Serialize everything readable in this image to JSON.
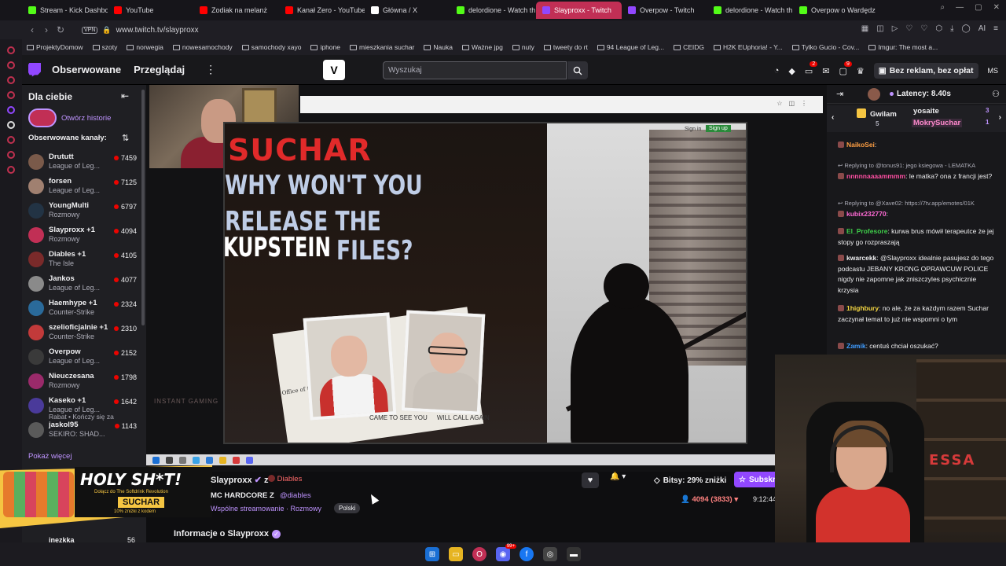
{
  "browser": {
    "tabs": [
      {
        "label": "Stream - Kick Dashbo",
        "color": "#53fc18"
      },
      {
        "label": "YouTube",
        "color": "#ff0000"
      },
      {
        "label": "Zodiak na melanż",
        "color": "#ff0000"
      },
      {
        "label": "Kanał Zero - YouTube",
        "color": "#ff0000"
      },
      {
        "label": "Główna / X",
        "color": "#ffffff"
      },
      {
        "label": "delordione - Watch th",
        "color": "#53fc18"
      },
      {
        "label": "Slayproxx - Twitch",
        "color": "#9147ff",
        "active": true
      },
      {
        "label": "Overpow - Twitch",
        "color": "#9147ff"
      },
      {
        "label": "delordione - Watch th",
        "color": "#53fc18"
      },
      {
        "label": "Overpow o Wardędz",
        "color": "#53fc18"
      }
    ],
    "vpn_label": "VPN",
    "url": "www.twitch.tv/slayproxx",
    "ai_label": "AI",
    "bookmarks": [
      "ProjektyDomow",
      "szoty",
      "norwegia",
      "nowesamochody",
      "samochody xayo",
      "iphone",
      "mieszkania suchar",
      "Nauka",
      "Ważne jpg",
      "nuty",
      "tweety do rt",
      "94 League of Leg...",
      "CEIDG",
      "H2K EUphoria! - Y...",
      "Tylko Gucio - Cov...",
      "Imgur: The most a..."
    ]
  },
  "twitch_nav": {
    "following": "Obserwowane",
    "browse": "Przeglądaj",
    "ext_logo": "V",
    "search_placeholder": "Wyszukaj",
    "notif_count_1": "2",
    "notif_count_2": "9",
    "no_ads": "Bez reklam, bez opłat",
    "avatar_initials": "MS"
  },
  "sidebar": {
    "for_you": "Dla ciebie",
    "open_stories": "Otwórz historie",
    "followed_channels": "Obserwowane kanały:",
    "channels": [
      {
        "name": "Drututt",
        "game": "League of Leg...",
        "viewers": "7459",
        "color": "#7a5a4a"
      },
      {
        "name": "forsen",
        "game": "League of Leg...",
        "viewers": "7125",
        "color": "#a08070"
      },
      {
        "name": "YoungMulti",
        "game": "Rozmowy",
        "viewers": "6797",
        "color": "#223344"
      },
      {
        "name": "Slayproxx +1",
        "game": "Rozmowy",
        "viewers": "4094",
        "color": "#c12f55"
      },
      {
        "name": "Diables +1",
        "game": "The Isle",
        "viewers": "4105",
        "color": "#7a2a2a"
      },
      {
        "name": "Jankos",
        "game": "League of Leg...",
        "viewers": "4077",
        "color": "#8a8a8a"
      },
      {
        "name": "Haemhype +1",
        "game": "Counter-Strike",
        "viewers": "2324",
        "color": "#2a6a9a"
      },
      {
        "name": "szelioficjalnie +1",
        "game": "Counter-Strike",
        "viewers": "2310",
        "color": "#c23a3a"
      },
      {
        "name": "Overpow",
        "game": "League of Leg...",
        "viewers": "2152",
        "color": "#3a3a3a"
      },
      {
        "name": "Nieuczesana",
        "game": "Rozmowy",
        "viewers": "1798",
        "color": "#9a2a6a"
      },
      {
        "name": "Kaseko +1",
        "game": "League of Leg...",
        "viewers": "1642",
        "color": "#4a3a9a"
      },
      {
        "name": "jaskol95",
        "game": "SEKIRO: SHAD...",
        "viewers": "1143",
        "color": "#5a5a5a"
      }
    ],
    "kaseko_note": "Rabat • Kończy się za",
    "show_more": "Pokaż więcej",
    "hidden_row_name": "inezkka",
    "hidden_row_viewers": "56"
  },
  "video": {
    "inner_signin": "Sign in",
    "inner_signup": "Sign up",
    "thumb_brand": "SUCHAR",
    "thumb_line1": "WHY WON'T YOU",
    "thumb_line2": "RELEASE THE",
    "thumb_kupstein": "KUPSTEIN",
    "thumb_files": "FILES?",
    "stamp_text": "Office of the Attorney General",
    "ticket1": "CAME TO SEE YOU",
    "ticket2": "WILL CALL AGAIN",
    "ic_logo": "INSTANT GAMING"
  },
  "chat": {
    "latency": "Latency: 8.40s",
    "gift_user_1": "Gwilam",
    "gift_count_1": "5",
    "gift_user_2": "yosaite",
    "gift_count_2": "3",
    "gift_user_3": "MokrySuchar",
    "gift_count_3": "1",
    "messages": [
      {
        "user": "NaikoSei",
        "user_color": "#ff9f43",
        "text": ":"
      },
      {
        "reply": "Replying to @tonus91: jego ksiegowa - LEMATKA"
      },
      {
        "user": "nnnnnaaaammmm",
        "user_color": "#ff4fa3",
        "text": ": le matka? ona z francji jest?"
      },
      {
        "reply": "Replying to @Xave02: https://7tv.app/emotes/01K"
      },
      {
        "user": "kubix232770",
        "user_color": "#ff6ad5",
        "text": ":"
      },
      {
        "user": "El_Profesore",
        "user_color": "#3fcf4a",
        "text": ": kurwa brus mówił terapeutce że jej stopy go rozpraszają"
      },
      {
        "user": "kwarcekk",
        "user_color": "#efeff1",
        "text": ": @Slayproxx idealnie pasujesz do tego podcastu JEBANY KRONG OPRAWCUW POLICE nigdy nie zapomne jak zniszczyles psychicznie krzysia"
      },
      {
        "user": "1highbury",
        "user_color": "#f5d742",
        "text": ": no ale, że za każdym razem Suchar zaczynał temat to już nie wspomni o tym"
      },
      {
        "user": "Zamik",
        "user_color": "#3f9cff",
        "text": ": centuś chciał oszukać?"
      }
    ]
  },
  "stream_info": {
    "streamer": "Slayproxx",
    "with_label": "z",
    "collab": "Diables",
    "title": "MC HARDCORE Z",
    "title_mention": "@diables",
    "category": "Wspólne streamowanie · Rozmowy",
    "language": "Polski",
    "about": "Informacje o Slayproxx",
    "bits": "Bitsy: 29% zniżki",
    "subscribe": "Subskrybuj",
    "viewers": "4094 (3833)",
    "uptime": "9:12:44"
  },
  "promo": {
    "headline": "HOLY SH*T!",
    "sub": "Dołącz do The Softdrink Revolution",
    "brand": "SUCHAR",
    "code": "10% zniżki z kodem"
  },
  "facecam": {
    "sign": "ESSA"
  },
  "taskbar": {
    "discord_badge": "99+"
  }
}
